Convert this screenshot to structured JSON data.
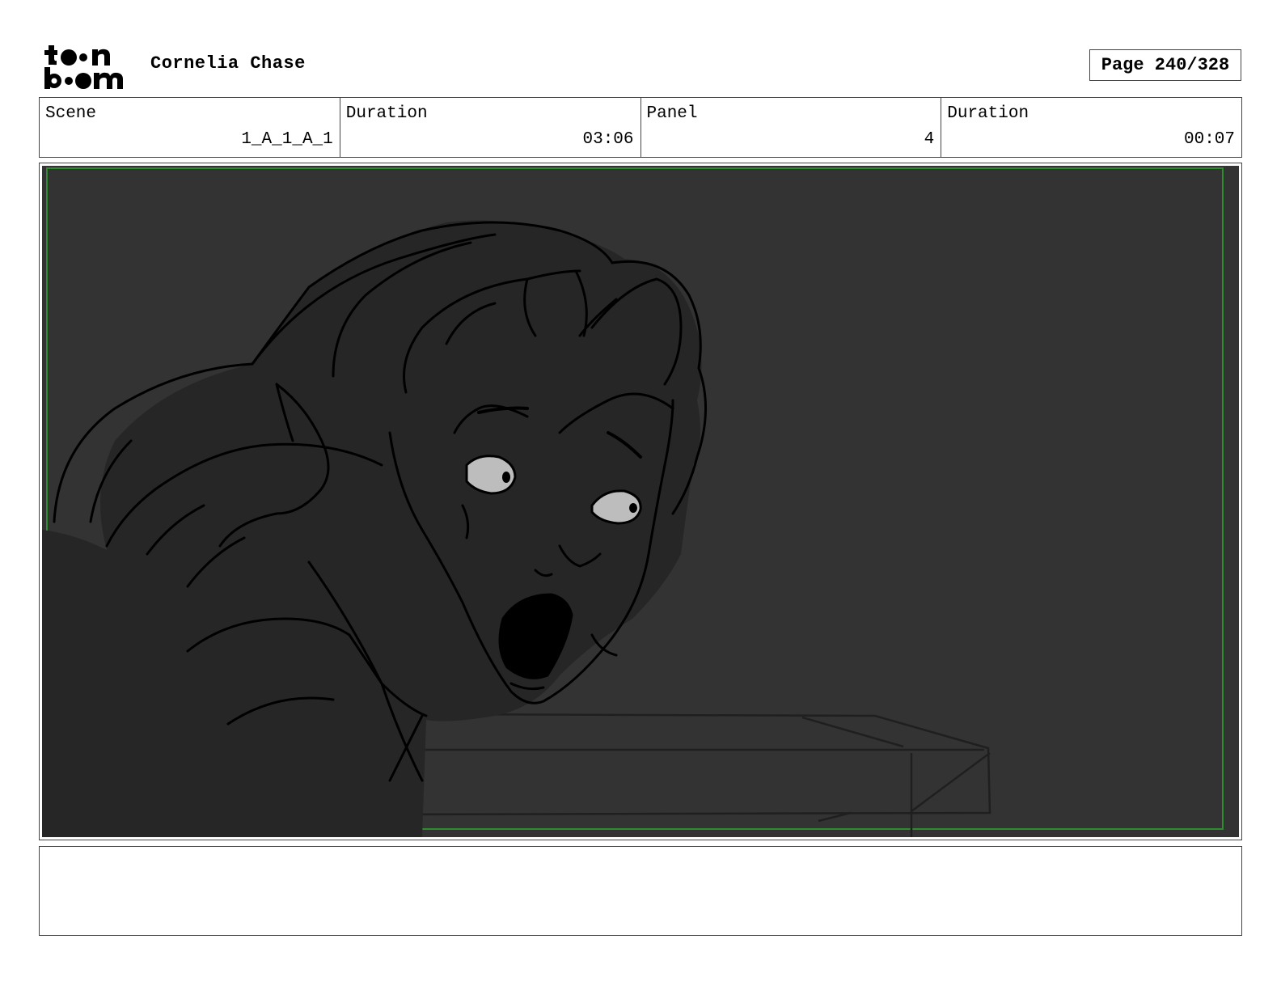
{
  "header": {
    "logo_text_top": "toon",
    "logo_text_bottom": "boom",
    "project_title": "Cornelia Chase",
    "page_label": "Page 240/328"
  },
  "info": {
    "scene_label": "Scene",
    "scene_value": "1_A_1_A_1",
    "scene_duration_label": "Duration",
    "scene_duration_value": "03:06",
    "panel_label": "Panel",
    "panel_value": "4",
    "panel_duration_label": "Duration",
    "panel_duration_value": "00:07"
  },
  "panel": {
    "background_color": "#333333",
    "safe_frame_color": "#2e8b2e",
    "figure_fill": "#262626",
    "eye_color": "#bdbdbd"
  },
  "notes": {
    "text": ""
  }
}
